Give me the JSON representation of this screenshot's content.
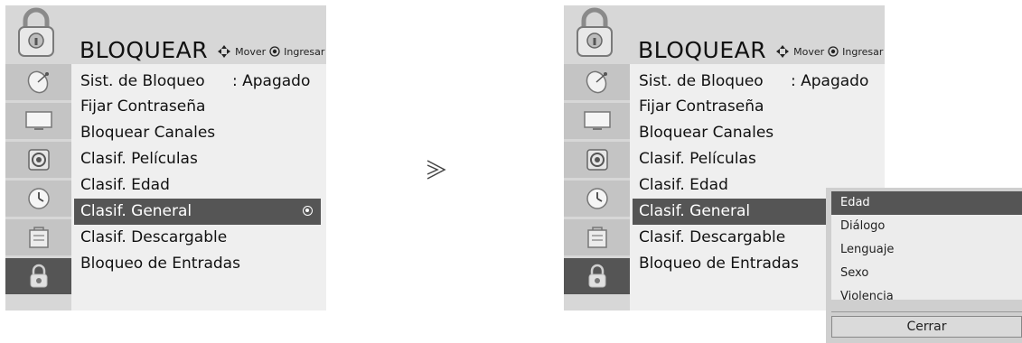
{
  "left_panel": {
    "title": "BLOQUEAR",
    "hint_move": "Mover",
    "hint_enter": "Ingresar",
    "menu": [
      {
        "label": "Sist. de Bloqueo",
        "value": ": Apagado"
      },
      {
        "label": "Fijar Contraseña"
      },
      {
        "label": "Bloquear Canales"
      },
      {
        "label": "Clasif. Películas"
      },
      {
        "label": "Clasif. Edad"
      },
      {
        "label": "Clasif. General",
        "selected": true
      },
      {
        "label": "Clasif. Descargable"
      },
      {
        "label": "Bloqueo de Entradas"
      }
    ]
  },
  "right_panel": {
    "title": "BLOQUEAR",
    "hint_move": "Mover",
    "hint_enter": "Ingresar",
    "menu": [
      {
        "label": "Sist. de Bloqueo",
        "value": ": Apagado"
      },
      {
        "label": "Fijar Contraseña"
      },
      {
        "label": "Bloquear Canales"
      },
      {
        "label": "Clasif. Películas"
      },
      {
        "label": "Clasif. Edad"
      },
      {
        "label": "Clasif. General",
        "selected": true
      },
      {
        "label": "Clasif. Descargable"
      },
      {
        "label": "Bloqueo de Entradas"
      }
    ]
  },
  "popup": {
    "options": [
      "Edad",
      "Diálogo",
      "Lenguaje",
      "Sexo",
      "Violencia"
    ],
    "selected": "Edad",
    "close_label": "Cerrar"
  },
  "sidebar_icons": [
    "satellite-dish-icon",
    "tv-screen-icon",
    "speaker-icon",
    "clock-icon",
    "option-box-icon",
    "lock-icon"
  ],
  "colors": {
    "panel_bg": "#d7d7d7",
    "menu_bg": "#efefef",
    "highlight": "#555555",
    "sidebar_cell": "#c4c4c4"
  }
}
